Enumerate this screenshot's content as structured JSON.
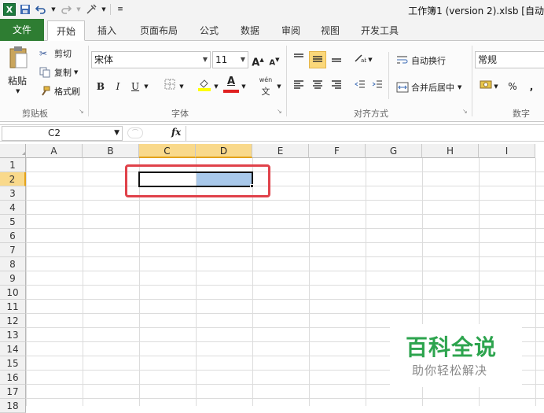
{
  "window": {
    "title": "工作簿1 (version 2).xlsb [自动",
    "app_icon": "excel-icon"
  },
  "quick_access": {
    "save": "save-icon",
    "undo": "undo-icon",
    "redo": "redo-icon",
    "tools": "tools-icon"
  },
  "tabs": {
    "file": "文件",
    "items": [
      "开始",
      "插入",
      "页面布局",
      "公式",
      "数据",
      "审阅",
      "视图",
      "开发工具"
    ],
    "active": "开始"
  },
  "clipboard": {
    "paste": "粘贴",
    "cut": "剪切",
    "copy": "复制",
    "format_painter": "格式刷",
    "label": "剪贴板"
  },
  "font": {
    "name": "宋体",
    "size": "11",
    "grow": "A",
    "shrink": "A",
    "bold": "B",
    "italic": "I",
    "underline": "U",
    "font_color_letter": "A",
    "phonetic": "wén",
    "label": "字体"
  },
  "alignment": {
    "wrap_text": "自动换行",
    "merge_center": "合并后居中",
    "label": "对齐方式"
  },
  "number": {
    "format": "常规",
    "percent": "%",
    "comma": ",",
    "label": "数字"
  },
  "formula_bar": {
    "name_box": "C2",
    "fx": "fx",
    "value": ""
  },
  "sheet": {
    "columns": [
      "A",
      "B",
      "C",
      "D",
      "E",
      "F",
      "G",
      "H",
      "I"
    ],
    "rows": [
      "1",
      "2",
      "3",
      "4",
      "5",
      "6",
      "7",
      "8",
      "9",
      "10",
      "11",
      "12",
      "13",
      "14",
      "15",
      "16",
      "17",
      "18"
    ],
    "selected_columns": [
      "C",
      "D"
    ],
    "selected_row": "2",
    "selection": "C2:D2"
  },
  "watermark": {
    "title": "百科全说",
    "subtitle": "助你轻松解决"
  },
  "colors": {
    "file_tab": "#2e7d32",
    "selection_fill": "#a8c8ea",
    "header_highlight": "#f9d98b",
    "annotation_red": "#e0424a",
    "watermark_green": "#2da44e"
  }
}
